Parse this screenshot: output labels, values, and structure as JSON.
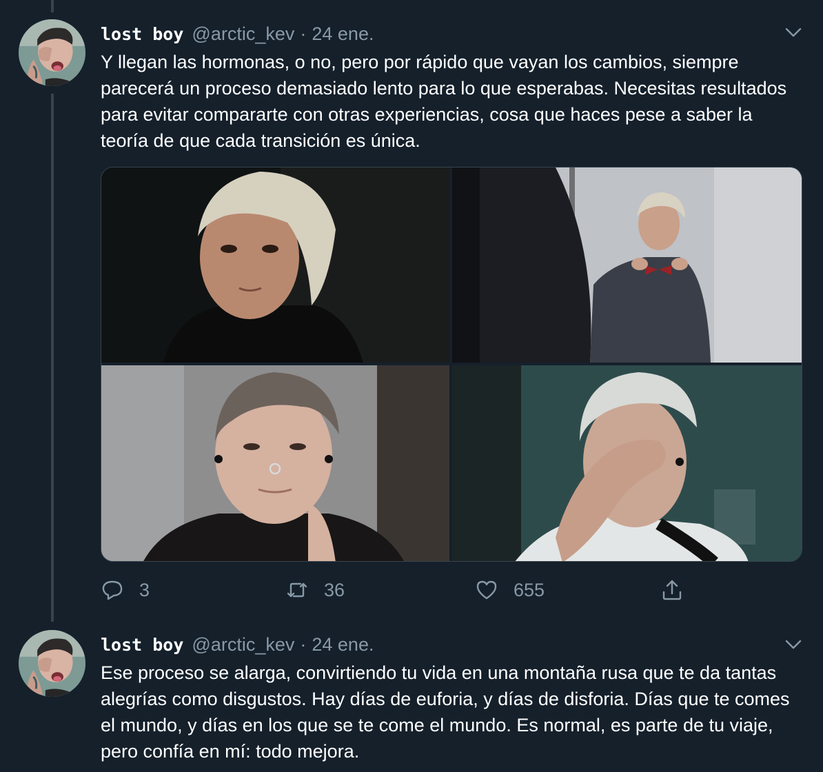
{
  "colors": {
    "background": "#15202b",
    "text": "#ffffff",
    "muted": "#8899a6",
    "thread_line": "#38444d"
  },
  "tweets": [
    {
      "name": "lost boy",
      "handle": "@arctic_kev",
      "dot": "·",
      "date": "24 ene.",
      "text": "Y llegan las hormonas, o no, pero por rápido que vayan los cambios, siempre parecerá un proceso demasiado lento para lo que esperabas. Necesitas resultados para evitar compararte con otras experiencias, cosa que haces pese a saber la teoría de que cada transición es única.",
      "media": [
        {
          "icon": "photo-selfie-dark"
        },
        {
          "icon": "photo-mirror-bowtie"
        },
        {
          "icon": "photo-septum-piercing"
        },
        {
          "icon": "photo-hand-over-face"
        }
      ],
      "actions": {
        "replies": "3",
        "retweets": "36",
        "likes": "655"
      }
    },
    {
      "name": "lost boy",
      "handle": "@arctic_kev",
      "dot": "·",
      "date": "24 ene.",
      "text": "Ese proceso se alarga, convirtiendo tu vida en una montaña rusa que te da tantas alegrías como disgustos. Hay días de euforia, y días de disforia. Días que te comes el mundo, y días en los que se te come el mundo. Es normal, es parte de tu viaje, pero confía en mí: todo mejora."
    }
  ],
  "icons": [
    "reply-icon",
    "retweet-icon",
    "like-icon",
    "share-icon",
    "chevron-down-icon"
  ]
}
